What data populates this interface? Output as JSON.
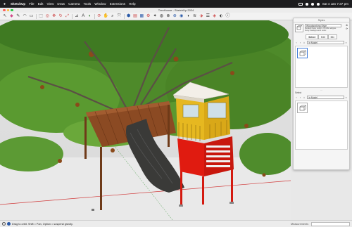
{
  "menubar": {
    "app": "SketchUp",
    "items": [
      "File",
      "Edit",
      "View",
      "Draw",
      "Camera",
      "Tools",
      "Window",
      "Extensions",
      "Help"
    ],
    "clock": "Sat 4 Jan  7:37 pm"
  },
  "window": {
    "title": "TreeHouse - SketchUp 2024"
  },
  "statusbar": {
    "hint": "Drag to orbit. Shift = Pan, Option = suspend gravity.",
    "measurements_label": "Measurements"
  },
  "tray": {
    "header": "Styles",
    "style_name": "Woodworking Style",
    "style_desc_line1": "Default face colors. Profile edges.",
    "style_desc_line2": "Gray background color.",
    "tabs": [
      "Select",
      "Edit",
      "Mix"
    ],
    "active_tab": "Select",
    "in_model_label": "In Model",
    "select_label": "Select",
    "in_model_label_2": "In Model"
  },
  "colors": {
    "menubar_bg": "#1d1d1f",
    "tree_leaf": "#4e8a2a",
    "wood_deck": "#8b4a23",
    "trunk": "#3a3a38",
    "stair_red": "#e01b10",
    "cabin_yellow": "#e6b820",
    "selection_blue": "#3f7ad8"
  }
}
